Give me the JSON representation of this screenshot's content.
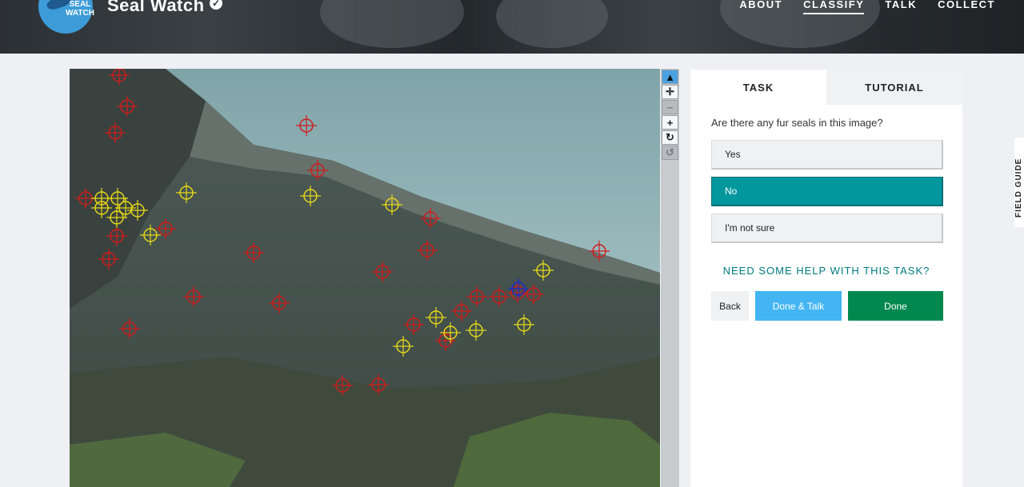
{
  "header": {
    "logo_text": "SEAL WATCH",
    "title": "Seal Watch",
    "nav": [
      "ABOUT",
      "CLASSIFY",
      "TALK",
      "COLLECT"
    ],
    "active_nav": "CLASSIFY"
  },
  "toolbar": {
    "tools": [
      {
        "name": "pointer-icon",
        "glyph": "▲",
        "state": "active"
      },
      {
        "name": "move-icon",
        "glyph": "✛",
        "state": "normal"
      },
      {
        "name": "zoom-out-icon",
        "glyph": "−",
        "state": "disabled"
      },
      {
        "name": "zoom-in-icon",
        "glyph": "+",
        "state": "normal"
      },
      {
        "name": "rotate-icon",
        "glyph": "↻",
        "state": "normal"
      },
      {
        "name": "reset-icon",
        "glyph": "↺",
        "state": "disabled"
      }
    ]
  },
  "task": {
    "tabs": [
      "TASK",
      "TUTORIAL"
    ],
    "question": "Are there any fur seals in this image?",
    "answers": [
      "Yes",
      "No",
      "I'm not sure"
    ],
    "selected_answer": "No",
    "help_link": "NEED SOME HELP WITH THIS TASK?",
    "buttons": {
      "back": "Back",
      "done_talk": "Done & Talk",
      "done": "Done"
    }
  },
  "field_guide": "FIELD GUIDE",
  "markers": {
    "colors": {
      "red": "#d01c1c",
      "yellow": "#e4d81a",
      "blue": "#1c2ad0"
    },
    "red_count": 26,
    "yellow_count": 16,
    "blue_count": 1
  }
}
